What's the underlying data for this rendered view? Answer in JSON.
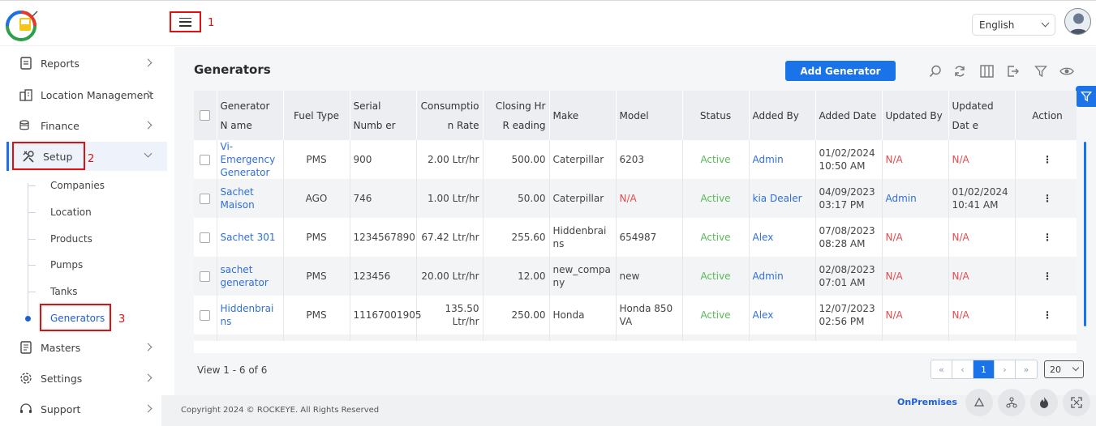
{
  "header": {
    "language": "English",
    "annotation_menu": "1"
  },
  "sidebar": {
    "items": [
      {
        "label": "Reports"
      },
      {
        "label": "Location Management"
      },
      {
        "label": "Finance"
      },
      {
        "label": "Setup"
      },
      {
        "label": "Masters"
      },
      {
        "label": "Settings"
      },
      {
        "label": "Support"
      }
    ],
    "setup_sub": [
      "Companies",
      "Location",
      "Products",
      "Pumps",
      "Tanks",
      "Generators"
    ],
    "annotation_setup": "2",
    "annotation_generators": "3"
  },
  "main": {
    "title": "Generators",
    "add_button": "Add Generator",
    "columns": [
      "Generator N ame",
      "Fuel Type",
      "Serial Numb er",
      "Consumptio n Rate",
      "Closing Hr R eading",
      "Make",
      "Model",
      "Status",
      "Added By",
      "Added Date",
      "Updated By",
      "Updated Dat e",
      "Action"
    ],
    "rows": [
      {
        "name": "Vi-Emergency Generator",
        "fuel": "PMS",
        "serial": "900",
        "rate": "2.00 Ltr/hr",
        "closing": "500.00",
        "make": "Caterpillar",
        "model": "6203",
        "status": "Active",
        "added_by": "Admin",
        "added_date": "01/02/2024 10:50 AM",
        "updated_by": "N/A",
        "updated_date": "N/A",
        "action": "⋮"
      },
      {
        "name": "Sachet Maison",
        "fuel": "AGO",
        "serial": "746",
        "rate": "1.00 Ltr/hr",
        "closing": "50.00",
        "make": "Caterpillar",
        "model": "N/A",
        "status": "Active",
        "added_by": "kia Dealer",
        "added_date": "04/09/2023 03:17 PM",
        "updated_by": "Admin",
        "updated_date": "01/02/2024 10:41 AM",
        "action": "⋮"
      },
      {
        "name": "Sachet 301",
        "fuel": "PMS",
        "serial": "1234567890",
        "rate": "67.42 Ltr/hr",
        "closing": "255.60",
        "make": "Hiddenbrains",
        "model": "654987",
        "status": "Active",
        "added_by": "Alex",
        "added_date": "07/08/2023 08:28 AM",
        "updated_by": "N/A",
        "updated_date": "N/A",
        "action": "⋮"
      },
      {
        "name": "sachet generator",
        "fuel": "PMS",
        "serial": "123456",
        "rate": "20.00 Ltr/hr",
        "closing": "12.00",
        "make": "new_company",
        "model": "new",
        "status": "Active",
        "added_by": "Admin",
        "added_date": "02/08/2023 07:01 AM",
        "updated_by": "N/A",
        "updated_date": "N/A",
        "action": "⋮"
      },
      {
        "name": "Hiddenbrains",
        "fuel": "PMS",
        "serial": "11167001905",
        "rate": "135.50 Ltr/hr",
        "closing": "250.00",
        "make": "Honda",
        "model": "Honda 850 VA",
        "status": "Active",
        "added_by": "Alex",
        "added_date": "12/07/2023 02:56 PM",
        "updated_by": "N/A",
        "updated_date": "N/A",
        "action": "⋮"
      }
    ],
    "view_count": "View 1 - 6 of 6",
    "pager": {
      "first": "«",
      "prev": "‹",
      "current": "1",
      "next": "›",
      "last": "»"
    },
    "page_size": "20"
  },
  "footer": {
    "copyright": "Copyright 2024 © ROCKEYE. All Rights Reserved",
    "mode": "OnPremises"
  },
  "colors": {
    "accent": "#1a73e8",
    "link": "#2f6fd6",
    "na": "#e24b4b",
    "active": "#5ab85a",
    "annotation": "#e01010"
  }
}
